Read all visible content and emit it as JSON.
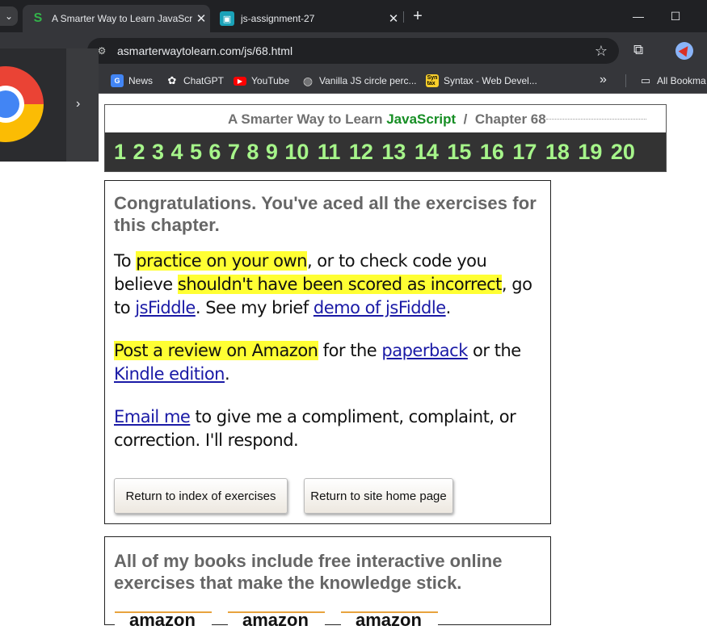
{
  "browser": {
    "tabs": [
      {
        "title": "A Smarter Way to Learn JavaScr",
        "favicon": "S",
        "active": true
      },
      {
        "title": "js-assignment-27",
        "favicon": "▣",
        "active": false
      }
    ],
    "url": "asmarterwaytolearn.com/js/68.html",
    "bookmarks": [
      {
        "label": "News",
        "icon": "news-icon"
      },
      {
        "label": "ChatGPT",
        "icon": "chatgpt-icon"
      },
      {
        "label": "YouTube",
        "icon": "youtube-icon"
      },
      {
        "label": "Vanilla JS circle perc...",
        "icon": "globe-icon"
      },
      {
        "label": "Syntax - Web Devel...",
        "icon": "syntax-icon"
      },
      {
        "label": "All Bookma",
        "icon": "folder-icon"
      }
    ]
  },
  "header": {
    "title_prefix": "A Smarter Way to Learn",
    "title_js": "JavaScript",
    "separator": "/",
    "chapter": "Chapter 68",
    "exercise_numbers": [
      "1",
      "2",
      "3",
      "4",
      "5",
      "6",
      "7",
      "8",
      "9",
      "10",
      "11",
      "12",
      "13",
      "14",
      "15",
      "16",
      "17",
      "18",
      "19",
      "20"
    ]
  },
  "main": {
    "heading": "Congratulations. You've aced all the exercises for this chapter.",
    "p1": {
      "t1": "To ",
      "h1": "practice on your own",
      "t2": ", or to check code you believe ",
      "h2": "shouldn't have been scored as incorrect",
      "t3": ", go to ",
      "link1": "jsFiddle",
      "t4": ". See my brief ",
      "link2": "demo of jsFiddle",
      "t5": "."
    },
    "p2": {
      "h1": "Post a review on Amazon",
      "t1": " for the ",
      "link1": "paperback",
      "t2": " or the ",
      "link2": "Kindle edition",
      "t3": "."
    },
    "p3": {
      "link1": "Email me",
      "t1": " to give me a compliment, complaint, or correction. I'll respond."
    },
    "buttons": {
      "index": "Return to index of exercises",
      "home": "Return to site home page"
    }
  },
  "books": {
    "heading": "All of my books include free interactive online exercises that make the knowledge stick.",
    "amazon_labels": [
      "amazon",
      "amazon",
      "amazon"
    ]
  }
}
